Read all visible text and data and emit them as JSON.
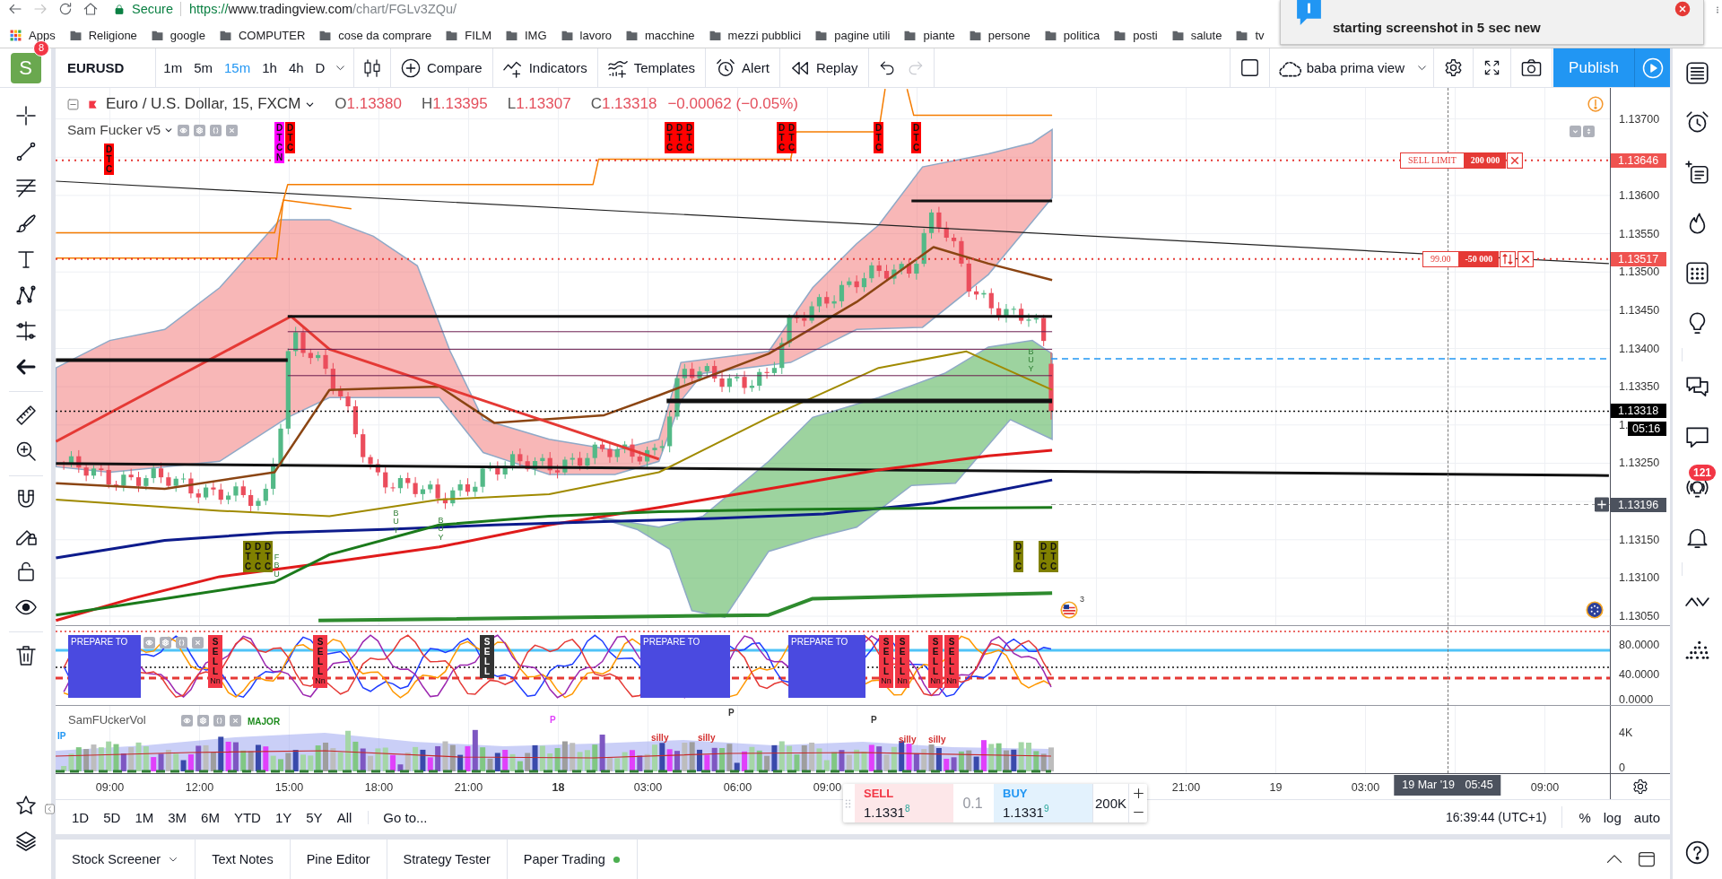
{
  "browser": {
    "forward_disabled": true,
    "secure_label": "Secure",
    "url_scheme": "https://",
    "url_host": "www.tradingview.com",
    "url_path": "/chart/FGLv3ZQu/",
    "bookmarks": [
      {
        "label": "Apps",
        "kind": "apps"
      },
      {
        "label": "Religione",
        "kind": "folder"
      },
      {
        "label": "google",
        "kind": "folder"
      },
      {
        "label": "COMPUTER",
        "kind": "folder"
      },
      {
        "label": "cose da comprare",
        "kind": "folder"
      },
      {
        "label": "FILM",
        "kind": "folder"
      },
      {
        "label": "IMG",
        "kind": "folder"
      },
      {
        "label": "lavoro",
        "kind": "folder"
      },
      {
        "label": "macchine",
        "kind": "folder"
      },
      {
        "label": "mezzi pubblici",
        "kind": "folder"
      },
      {
        "label": "pagine utili",
        "kind": "folder"
      },
      {
        "label": "piante",
        "kind": "folder"
      },
      {
        "label": "persone",
        "kind": "folder"
      },
      {
        "label": "politica",
        "kind": "folder"
      },
      {
        "label": "posti",
        "kind": "folder"
      },
      {
        "label": "salute",
        "kind": "folder"
      },
      {
        "label": "tv",
        "kind": "folder"
      }
    ],
    "notification": "starting screenshot in 5 sec new"
  },
  "header": {
    "avatar_letter": "S",
    "avatar_badge": "8",
    "symbol": "EURUSD",
    "intervals": [
      {
        "label": "1m",
        "selected": false
      },
      {
        "label": "5m",
        "selected": false
      },
      {
        "label": "15m",
        "selected": true
      },
      {
        "label": "1h",
        "selected": false
      },
      {
        "label": "4h",
        "selected": false
      },
      {
        "label": "D",
        "selected": false
      }
    ],
    "tools": [
      {
        "kind": "compare",
        "label": "Compare"
      },
      {
        "kind": "indicators",
        "label": "Indicators"
      },
      {
        "kind": "templates",
        "label": "Templates"
      },
      {
        "kind": "alert",
        "label": "Alert"
      },
      {
        "kind": "replay",
        "label": "Replay"
      }
    ],
    "redo_disabled": true,
    "layout_name": "baba prima view",
    "publish": "Publish"
  },
  "legend": {
    "title": "Euro / U.S. Dollar, 15, FXCM",
    "ohlc": [
      {
        "key": "O",
        "value": "1.13380"
      },
      {
        "key": "H",
        "value": "1.13395"
      },
      {
        "key": "L",
        "value": "1.13307"
      },
      {
        "key": "C",
        "value": "1.13318"
      }
    ],
    "change": "−0.00062 (−0.05%)",
    "indicator": "Sam Fucker v5"
  },
  "main_pane": {
    "signals": [
      {
        "text": "DTC",
        "color": "#ff0000"
      },
      {
        "text": "DTCN",
        "color": "#ff00ff"
      },
      {
        "text": "DTC",
        "color": "#ff0000"
      },
      {
        "text": "DTC",
        "color": "#ff0000"
      },
      {
        "text": "DTC",
        "color": "#ff0000"
      },
      {
        "text": "DTC",
        "color": "#ff0000"
      },
      {
        "text": "DTC",
        "color": "#ff0000"
      },
      {
        "text": "DTC",
        "color": "#ff0000"
      },
      {
        "text": "DTC",
        "color": "#ff0000"
      },
      {
        "text": "DTC",
        "color": "#ff0000"
      },
      {
        "text": "DTC",
        "color": "#808000"
      },
      {
        "text": "DTC",
        "color": "#808000"
      },
      {
        "text": "DTC",
        "color": "#808000"
      },
      {
        "text": "DTC",
        "color": "#808000"
      },
      {
        "text": "DTC",
        "color": "#808000"
      },
      {
        "text": "DTC",
        "color": "#808000"
      }
    ],
    "buy_marks": [
      "BUY",
      "BUY",
      "BUY",
      "FBU"
    ],
    "order_lines": [
      {
        "kind": "limit",
        "label": "SELL LIMIT",
        "quantity": "200 000"
      },
      {
        "kind": "position",
        "label": "99.00",
        "quantity": "-50 000"
      }
    ],
    "event_count": "3"
  },
  "price_scale": {
    "ticks": [
      "1.13700",
      "1.13600",
      "1.13550",
      "1.13500",
      "1.13450",
      "1.13400",
      "1.13350",
      "1.",
      "1.13250",
      "1.13150",
      "1.13100",
      "1.13050"
    ],
    "labels": [
      {
        "text": "1.13646",
        "kind": "order"
      },
      {
        "text": "1.13517",
        "kind": "order"
      },
      {
        "text": "1.13318",
        "kind": "last"
      },
      {
        "text": "05:16",
        "kind": "countdown"
      },
      {
        "text": "1.13196",
        "kind": "crosshair"
      }
    ]
  },
  "oscillator_pane": {
    "signals": [
      {
        "kind": "prepare",
        "text": "PREPARE TO",
        "color": "#4a4ae0"
      },
      {
        "kind": "sell",
        "text": "SELL",
        "tag": "Nn",
        "color": "#f23645"
      },
      {
        "kind": "sell",
        "text": "SELL",
        "tag": "Nn",
        "color": "#f23645"
      },
      {
        "kind": "sell",
        "text": "SELL",
        "color": "#333333"
      },
      {
        "kind": "prepare",
        "text": "PREPARE TO",
        "color": "#4a4ae0"
      },
      {
        "kind": "prepare",
        "text": "PREPARE TO",
        "color": "#4a4ae0"
      },
      {
        "kind": "sell",
        "text": "SELL",
        "tag": "Nn",
        "color": "#f23645"
      },
      {
        "kind": "sell",
        "text": "SELL",
        "tag": "Nn",
        "color": "#f23645"
      },
      {
        "kind": "sell",
        "text": "SELL",
        "tag": "Nn",
        "color": "#f23645"
      },
      {
        "kind": "sell",
        "text": "SELL",
        "tag": "Nn",
        "color": "#f23645"
      }
    ],
    "ticks": [
      "80.0000",
      "40.0000",
      "0.0000"
    ]
  },
  "volume_pane": {
    "title": "SamFUckerVol",
    "labels": [
      {
        "text": "IP",
        "color": "#2196f3"
      },
      {
        "text": "MAJOR",
        "color": "#1b8a1b"
      },
      {
        "text": "P",
        "color": "#e040fb"
      },
      {
        "text": "silly",
        "color": "#d32f2f"
      },
      {
        "text": "silly",
        "color": "#d32f2f"
      },
      {
        "text": "P",
        "color": "#333333"
      },
      {
        "text": "P",
        "color": "#333333"
      },
      {
        "text": "silly",
        "color": "#d32f2f"
      },
      {
        "text": "silly",
        "color": "#d32f2f"
      }
    ],
    "ticks": [
      "4K",
      "0"
    ]
  },
  "time_axis": {
    "ticks": [
      {
        "label": "09:00",
        "bold": false
      },
      {
        "label": "12:00",
        "bold": false
      },
      {
        "label": "15:00",
        "bold": false
      },
      {
        "label": "18:00",
        "bold": false
      },
      {
        "label": "21:00",
        "bold": false
      },
      {
        "label": "18",
        "bold": true
      },
      {
        "label": "03:00",
        "bold": false
      },
      {
        "label": "06:00",
        "bold": false
      },
      {
        "label": "09:00",
        "bold": false
      },
      {
        "label": "21:00",
        "bold": false
      },
      {
        "label": "19",
        "bold": false
      },
      {
        "label": "03:00",
        "bold": false
      },
      {
        "label": "09:00",
        "bold": false
      }
    ],
    "crosshair_date": "19 Mar '19",
    "crosshair_time": "05:45"
  },
  "trade_panel": {
    "sell_label": "SELL",
    "sell_price": "1.1331$^{8}$",
    "spread": "0.1",
    "buy_label": "BUY",
    "buy_price": "1.1331$^{9}$",
    "amount": "200K"
  },
  "range_bar": {
    "ranges": [
      "1D",
      "5D",
      "1M",
      "3M",
      "6M",
      "YTD",
      "1Y",
      "5Y",
      "All"
    ],
    "goto": "Go to...",
    "clock": "16:39:44 (UTC+1)",
    "scale_buttons": [
      "%",
      "log",
      "auto"
    ]
  },
  "bottom_tabs": [
    {
      "label": "Stock Screener",
      "kind": "dropdown"
    },
    {
      "label": "Text Notes",
      "kind": "plain"
    },
    {
      "label": "Pine Editor",
      "kind": "plain"
    },
    {
      "label": "Strategy Tester",
      "kind": "plain"
    },
    {
      "label": "Paper Trading",
      "kind": "status"
    }
  ],
  "right_sidebar": {
    "badge": "121"
  }
}
